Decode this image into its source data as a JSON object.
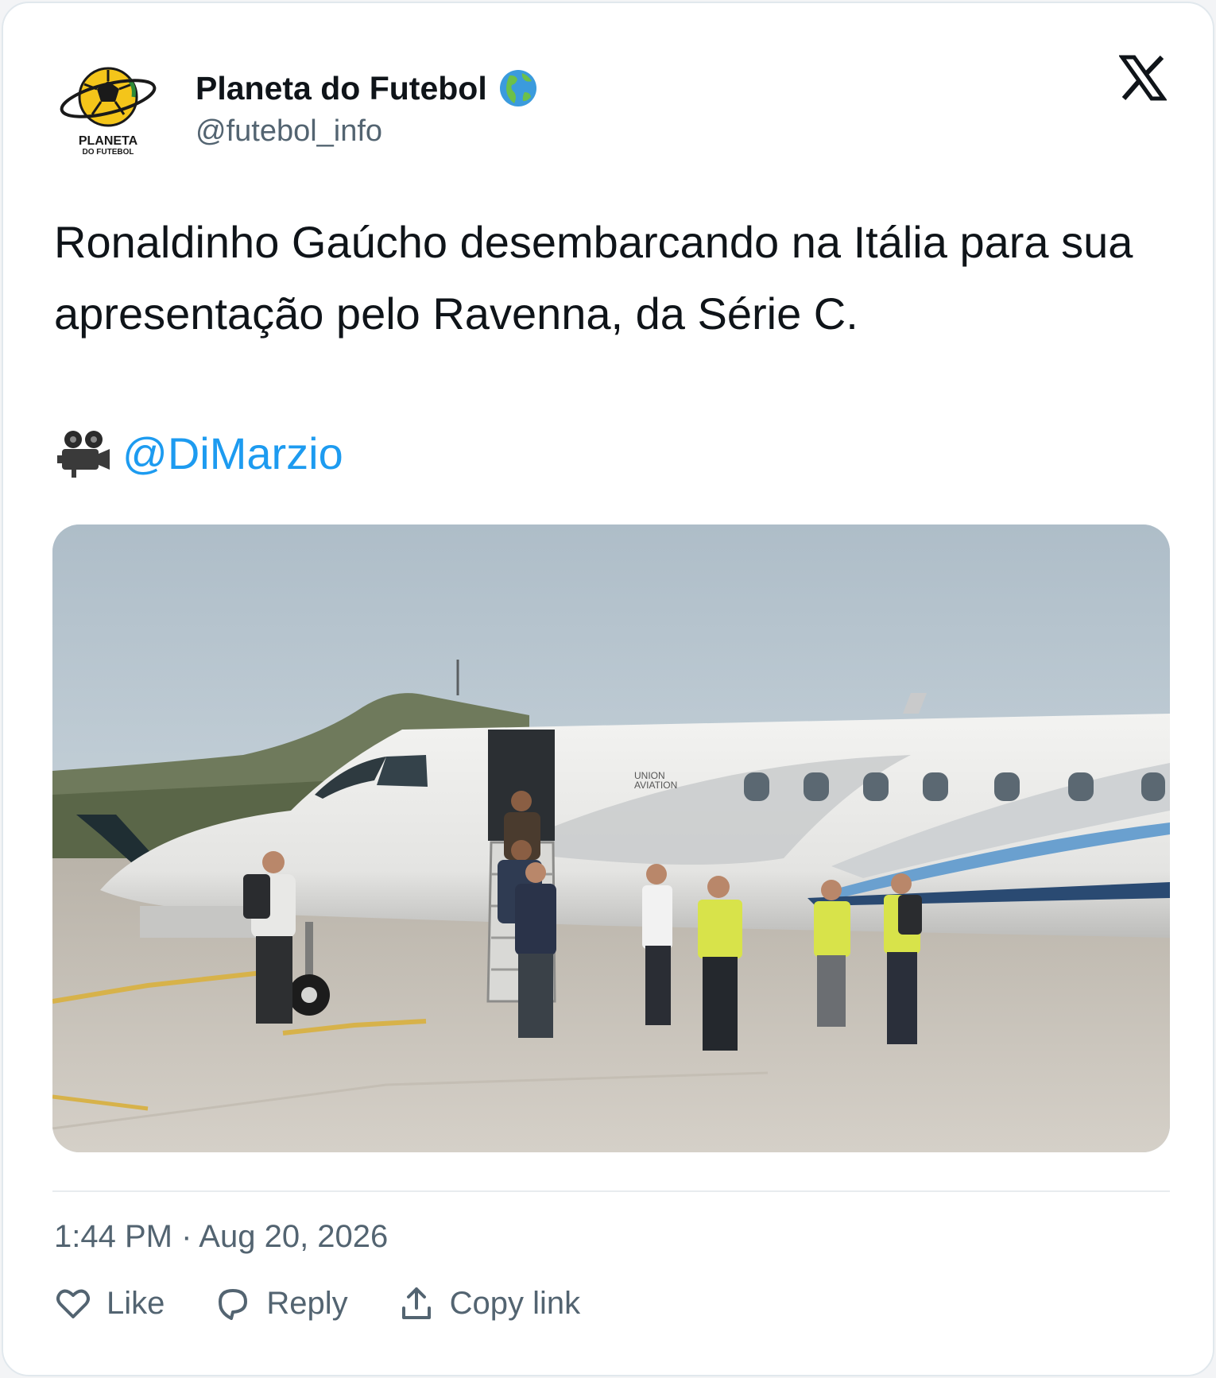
{
  "author": {
    "name": "Planeta do Futebol",
    "handle": "@futebol_info",
    "verified_emoji_icon": "globe-americas-icon",
    "avatar": {
      "logo_text_line1": "PLANETA",
      "logo_text_line2": "DO FUTEBOL"
    }
  },
  "platform_icon": "x-logo-icon",
  "tweet": {
    "text": "Ronaldinho Gaúcho desembarcando na Itália para sua apresentação pelo Ravenna, da Série C.",
    "credit_icon": "movie-camera-icon",
    "mention": "@DiMarzio"
  },
  "media": {
    "type": "video-thumbnail",
    "aircraft_livery_line1": "UNION",
    "aircraft_livery_line2": "AVIATION"
  },
  "timestamp": "1:44 PM · Aug 20, 2026",
  "actions": [
    {
      "label": "Like",
      "icon": "heart-icon"
    },
    {
      "label": "Reply",
      "icon": "speech-bubble-icon"
    },
    {
      "label": "Copy link",
      "icon": "upload-icon"
    }
  ],
  "colors": {
    "mention": "#1d9bf0",
    "secondary_text": "#536471",
    "primary_text": "#0f1419"
  }
}
